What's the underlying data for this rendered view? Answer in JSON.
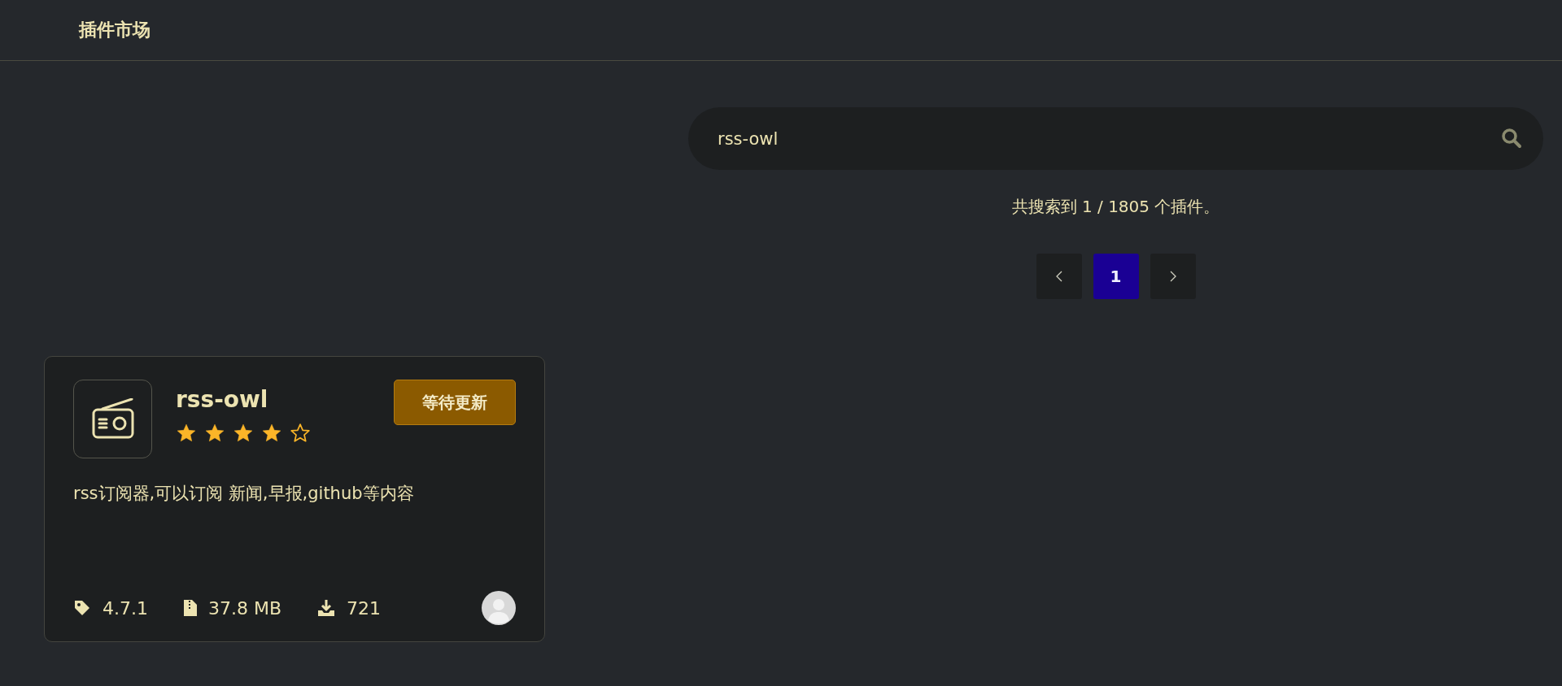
{
  "header": {
    "title": "插件市场"
  },
  "search": {
    "value": "rss-owl"
  },
  "result_summary": "共搜索到 1 / 1805 个插件。",
  "pagination": {
    "pages": [
      {
        "label": "1",
        "selected": true
      }
    ]
  },
  "plugins": [
    {
      "name": "rss-owl",
      "stars": 4,
      "status": "等待更新",
      "description": "rss订阅器,可以订阅 新闻,早报,github等内容",
      "version": "4.7.1",
      "size": "37.8 MB",
      "downloads": "721"
    }
  ]
}
